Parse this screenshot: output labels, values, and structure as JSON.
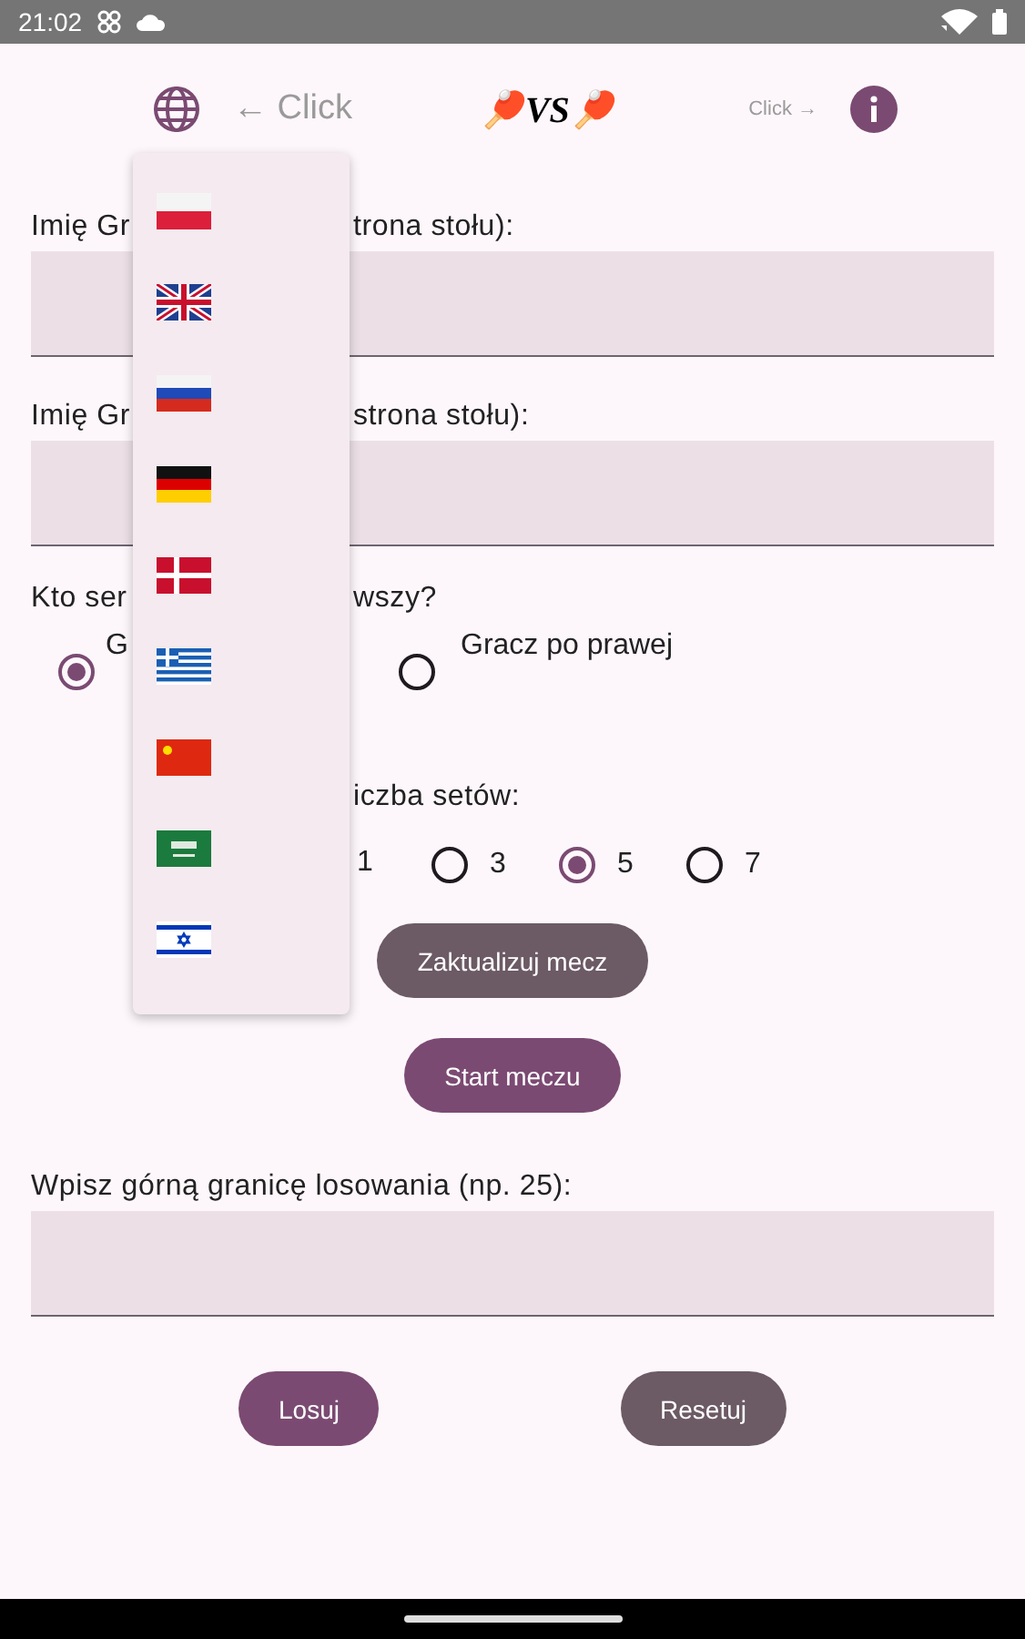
{
  "status_bar": {
    "time": "21:02"
  },
  "header": {
    "left_hint": "← Click",
    "title": "🏓VS🏓",
    "right_hint": "Click →"
  },
  "language_menu": {
    "items": [
      {
        "kind": "poland"
      },
      {
        "kind": "uk"
      },
      {
        "kind": "russia"
      },
      {
        "kind": "germany"
      },
      {
        "kind": "denmark"
      },
      {
        "kind": "greece"
      },
      {
        "kind": "china"
      },
      {
        "kind": "saudi"
      },
      {
        "kind": "israel"
      }
    ]
  },
  "player_fields": [
    {
      "label_start": "Imię Gr",
      "label_end": "trona stołu):"
    },
    {
      "label_start": "Imię Gr",
      "label_end": "strona stołu):"
    }
  ],
  "serve": {
    "question_start": "Kto ser",
    "question_end": "wszy?",
    "options": [
      {
        "label": "G",
        "selected": true
      },
      {
        "label": "Gracz po prawej",
        "selected": false
      }
    ]
  },
  "sets": {
    "label": "iczba setów:",
    "options": [
      {
        "label": "1"
      },
      {
        "label": "3",
        "selected": false
      },
      {
        "label": "5",
        "selected": true
      },
      {
        "label": "7",
        "selected": false
      }
    ]
  },
  "buttons": [
    {
      "label": "Zaktualizuj mecz",
      "kind": "secondary"
    },
    {
      "label": "Start meczu",
      "kind": "primary"
    }
  ],
  "draw": {
    "label": "Wpisz górną granicę losowania (np. 25):"
  },
  "bottom_buttons": [
    {
      "label": "Losuj",
      "kind": "primary"
    },
    {
      "label": "Resetuj",
      "kind": "secondary"
    }
  ]
}
